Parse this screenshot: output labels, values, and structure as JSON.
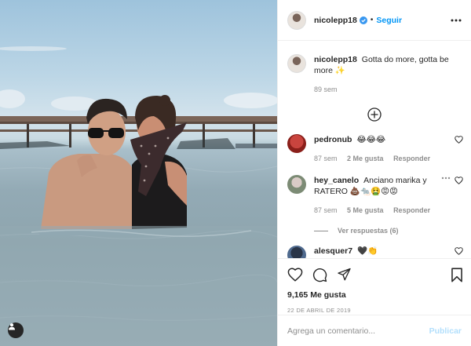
{
  "post": {
    "author": "nicolepp18",
    "follow_label": "Seguir",
    "separator": "•",
    "caption_text": "Gotta do more, gotta be more ✨",
    "caption_age": "89 sem",
    "likes": "9,165 Me gusta",
    "date": "22 DE ABRIL DE 2019"
  },
  "comments": [
    {
      "user": "pedronub",
      "text": "😂😂😂",
      "age": "87 sem",
      "likes": "2 Me gusta",
      "reply_label": "Responder"
    },
    {
      "user": "hey_canelo",
      "text": "Anciano marika y RATERO 💩🐀🤮😡😡",
      "age": "87 sem",
      "likes": "5 Me gusta",
      "reply_label": "Responder",
      "view_replies": "Ver respuestas (6)"
    },
    {
      "user": "alesquer7",
      "text": "🖤👏"
    }
  ],
  "composer": {
    "placeholder": "Agrega un comentario...",
    "publish_label": "Publicar"
  },
  "colors": {
    "accent": "#0095f6",
    "publish_disabled": "#b2dffc",
    "muted": "#8e8e8e",
    "text": "#262626"
  },
  "icons": {
    "verified": "verified-badge-icon",
    "more": "more-options-icon",
    "load_more": "plus-circle-icon",
    "like": "heart-icon",
    "comment": "comment-icon",
    "share": "share-icon",
    "save": "bookmark-icon",
    "tag": "user-tag-icon"
  }
}
